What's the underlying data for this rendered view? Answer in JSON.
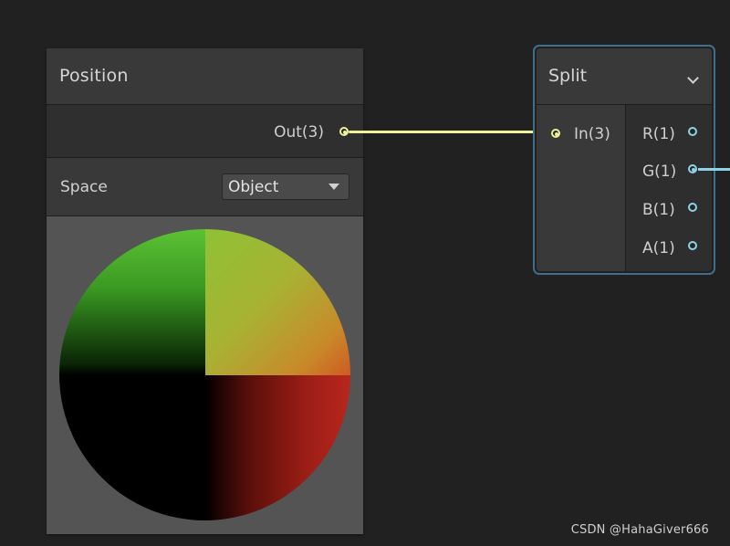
{
  "position_node": {
    "title": "Position",
    "output_label": "Out(3)",
    "space_label": "Space",
    "space_value": "Object"
  },
  "split_node": {
    "title": "Split",
    "input_label": "In(3)",
    "outputs": [
      {
        "label": "R(1)",
        "connected": false
      },
      {
        "label": "G(1)",
        "connected": true
      },
      {
        "label": "B(1)",
        "connected": false
      },
      {
        "label": "A(1)",
        "connected": false
      }
    ]
  },
  "icons": {
    "dropdown": "triangle-down-icon",
    "collapse": "chevron-down-icon"
  },
  "colors": {
    "background": "#212121",
    "vector3_port": "#f0ef9a",
    "vector1_port": "#8fd3e6",
    "selection_outline": "#3f6f8e"
  },
  "watermark": "CSDN @HahaGiver666"
}
